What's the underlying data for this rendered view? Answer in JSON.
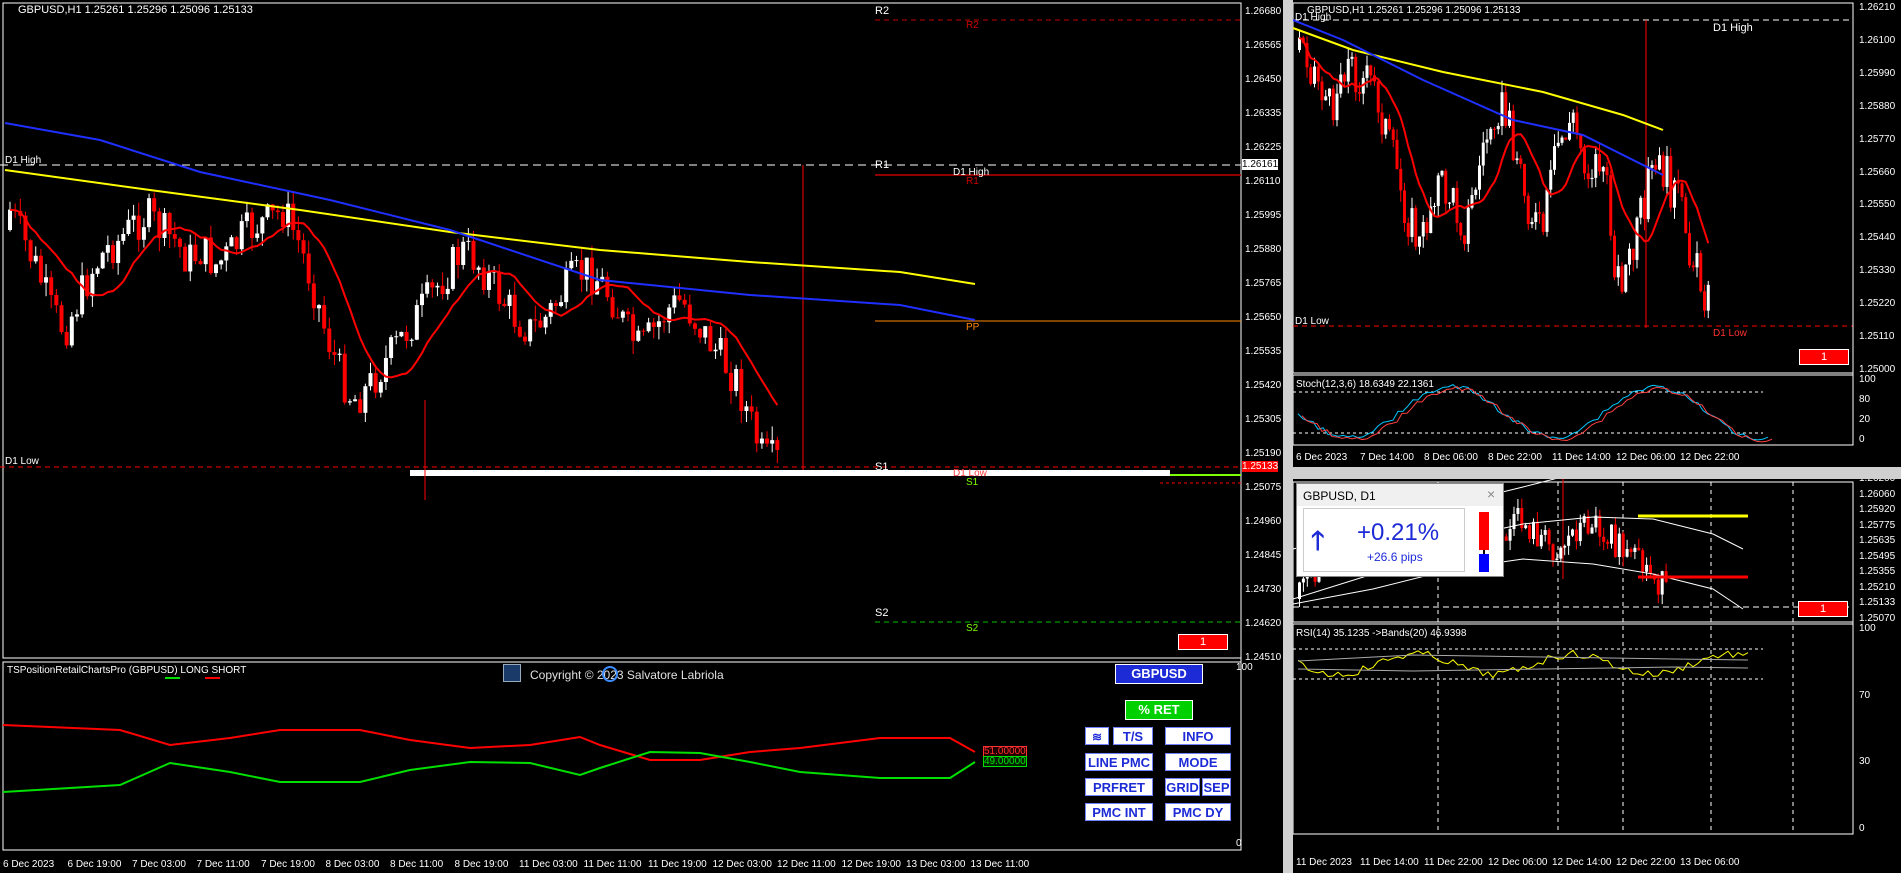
{
  "colors": {
    "up": "#ffffff",
    "down": "#ff0000",
    "ma_fast": "#ff0000",
    "ma_mid": "#1f2fff",
    "ma_slow": "#ffff00",
    "grid": "#ffffff",
    "stoch": "#00c8ff",
    "rsi": "#ffff00",
    "long_line": "#ff0000",
    "short_line": "#00e000",
    "bb": "#ffffff",
    "button_text": "#1d2bd6"
  },
  "main": {
    "title": "GBPUSD,H1  1.25261 1.25296 1.25096 1.25133",
    "price_axis": [
      "1.26680",
      "1.26565",
      "1.26450",
      "1.26335",
      "1.26225",
      "1.26110",
      "1.25995",
      "1.25880",
      "1.25765",
      "1.25650",
      "1.25535",
      "1.25420",
      "1.25305",
      "1.25190",
      "1.25075",
      "1.24960",
      "1.24845",
      "1.24730",
      "1.24620",
      "1.24510"
    ],
    "time_axis": [
      "6 Dec 2023",
      "6 Dec 19:00",
      "7 Dec 03:00",
      "7 Dec 11:00",
      "7 Dec 19:00",
      "8 Dec 03:00",
      "8 Dec 11:00",
      "8 Dec 19:00",
      "11 Dec 03:00",
      "11 Dec 11:00",
      "11 Dec 19:00",
      "12 Dec 03:00",
      "12 Dec 11:00",
      "12 Dec 19:00",
      "13 Dec 03:00",
      "13 Dec 11:00"
    ],
    "labels": {
      "d1_high": "D1 High",
      "d1_low": "D1 Low",
      "r2": "R2",
      "r2r": "R2",
      "r1": "R1",
      "r1r": "R1",
      "pp": "PP",
      "s1": "S1",
      "s1g": "S1",
      "s2": "S2",
      "s2g": "S2",
      "d1_high_mid": "D1 High",
      "d1_low_mid": "D1 Low",
      "tag": "1"
    },
    "d1_high_price": "1.26161",
    "current_price": "1.25133"
  },
  "indicator": {
    "title": "TSPositionRetailChartsPro (GBPUSD) LONG SHORT",
    "copyright": "Copyright © 2023 Salvatore Labriola",
    "symbol_button": "GBPUSD",
    "ret_button": "% RET",
    "buttons": [
      "T/S",
      "INFO",
      "LINE PMC",
      "MODE",
      "PRFRET",
      "GRID",
      "SEP",
      "PMC INT",
      "PMC DY"
    ],
    "value_long": "51.00000",
    "value_short": "49.00000",
    "axis": [
      "100",
      "0"
    ]
  },
  "right_top": {
    "title": "GBPUSD,H1  1.25261 1.25296 1.25096 1.25133",
    "price_axis": [
      "1.26210",
      "1.26100",
      "1.25990",
      "1.25880",
      "1.25770",
      "1.25660",
      "1.25550",
      "1.25440",
      "1.25330",
      "1.25220",
      "1.25110",
      "1.25000"
    ],
    "labels": {
      "d1_high_left": "D1 High",
      "d1_high": "D1 High",
      "d1_low_left": "D1 Low",
      "d1_low": "D1 Low",
      "tag": "1"
    },
    "stoch_title": "Stoch(12,3,6) 18.6349 22.1361",
    "stoch_axis": [
      "100",
      "80",
      "20",
      "0"
    ],
    "time_axis": [
      "6 Dec 2023",
      "7 Dec 14:00",
      "8 Dec 06:00",
      "8 Dec 22:00",
      "11 Dec 14:00",
      "12 Dec 06:00",
      "12 Dec 22:00"
    ]
  },
  "right_bottom": {
    "popup_title": "GBPUSD, D1",
    "popup_percent": "+0.21%",
    "popup_pips": "+26.6 pips",
    "price_axis": [
      "1.26200",
      "1.26060",
      "1.25920",
      "1.25775",
      "1.25635",
      "1.25495",
      "1.25355",
      "1.25210",
      "1.25133",
      "1.25070"
    ],
    "current_price": "1.25133",
    "tag": "1",
    "rsi_title": "RSI(14) 35.1235  ->Bands(20) 46.9398",
    "rsi_axis": [
      "100",
      "70",
      "30",
      "0"
    ],
    "time_axis": [
      "11 Dec 2023",
      "11 Dec 14:00",
      "11 Dec 22:00",
      "12 Dec 06:00",
      "12 Dec 14:00",
      "12 Dec 22:00",
      "13 Dec 06:00"
    ]
  }
}
